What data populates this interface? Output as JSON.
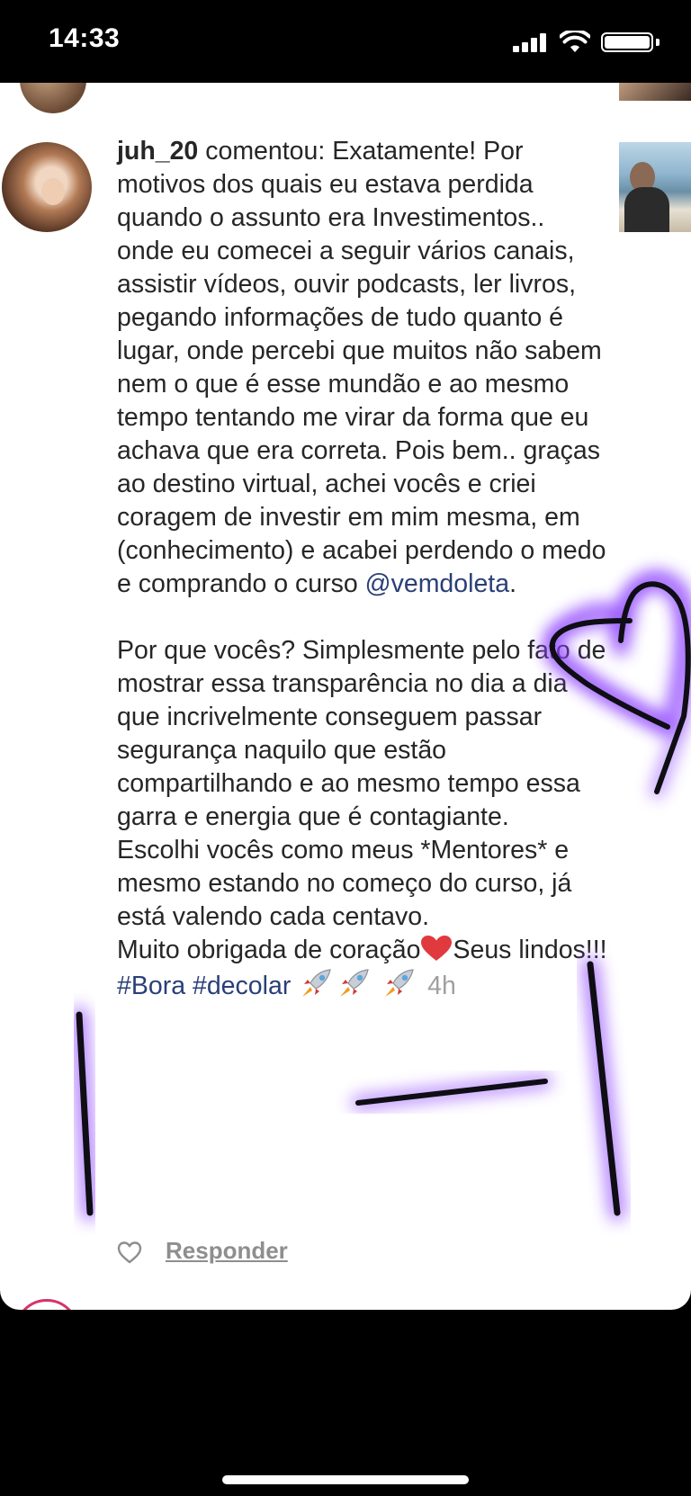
{
  "status_bar": {
    "time": "14:33",
    "icons": [
      "cellular-signal-icon",
      "wifi-icon",
      "battery-icon"
    ]
  },
  "comment": {
    "username": "juh_20",
    "action": " comentou: ",
    "paragraph1": "Exatamente! Por motivos dos quais eu estava perdida quando o assunto era Investimentos.. onde eu comecei a seguir vários canais, assistir vídeos, ouvir podcasts, ler livros, pegando informações de tudo quanto é lugar, onde percebi que muitos não sabem nem o que é esse mundão e ao mesmo tempo tentando me virar da forma que eu achava que era correta. Pois bem.. graças ao destino virtual, achei vocês e criei coragem de investir em mim mesma, em (conhecimento) e acabei perdendo o medo e comprando o curso ",
    "mention": "@vemdoleta",
    "mention_suffix": ".",
    "paragraph2": "Por que vocês? Simplesmente pelo fato de mostrar essa transparência no dia a dia que incrivelmente conseguem passar segurança naquilo que estão compartilhando e ao mesmo tempo essa garra e energia que é contagiante.",
    "paragraph3": "Escolhi vocês como meus *Mentores* e mesmo estando no começo do curso, já está valendo cada centavo.",
    "paragraph4_pre": "Muito obrigada de coração",
    "paragraph4_post": "Seus lindos!!! ",
    "hashtag1": "#Bora",
    "hashtag2": "#decolar",
    "timestamp": "4h"
  },
  "actions": {
    "like_icon": "heart-outline-icon",
    "reply_label": "Responder"
  },
  "colors": {
    "link": "#2a3f77",
    "text": "#262626",
    "muted": "#8e8e8e",
    "scribble_glow": "#8a3dff"
  }
}
